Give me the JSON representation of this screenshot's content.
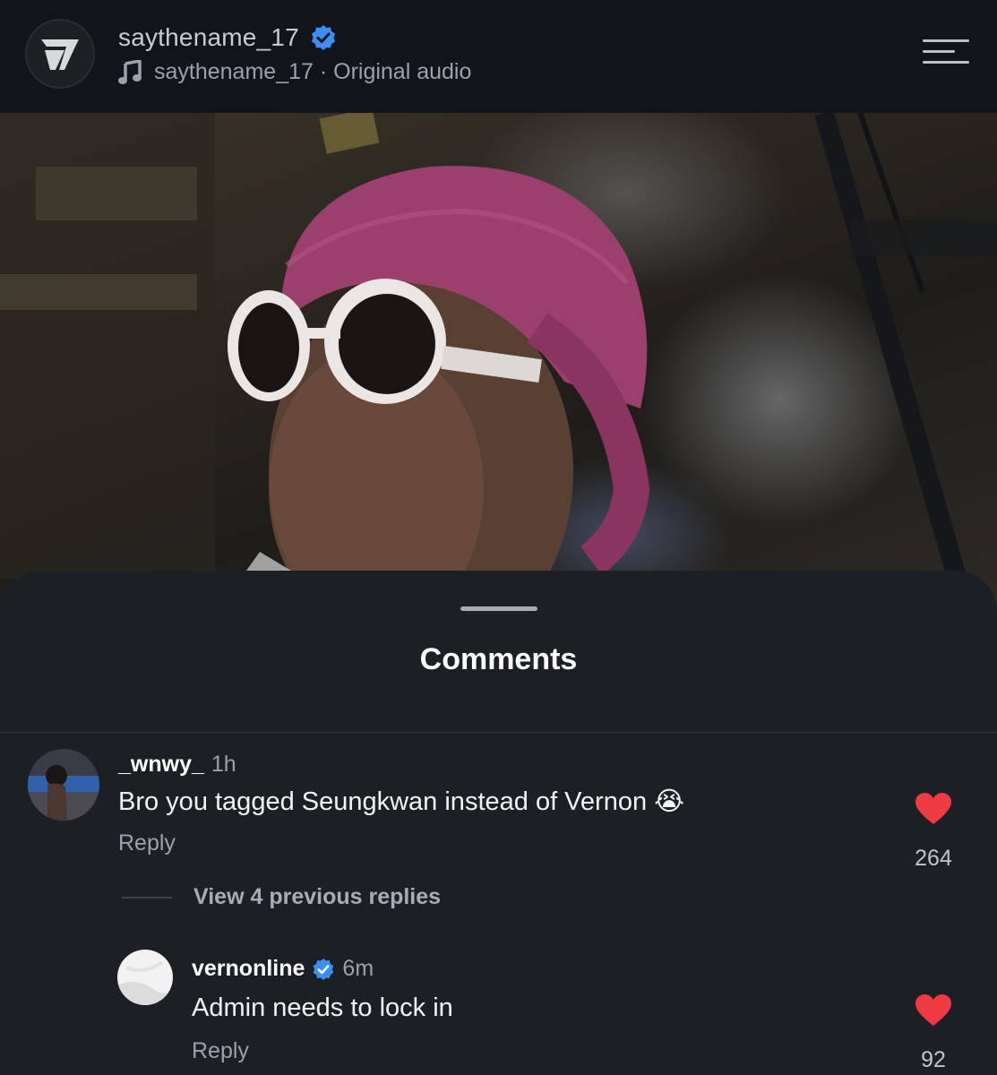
{
  "header": {
    "username": "saythename_17",
    "audio_text": "saythename_17 · Original audio",
    "icons": {
      "logo": "seventeen-logo-icon",
      "verified": "verified-badge-icon",
      "audio": "music-note-icon",
      "menu": "menu-icon"
    }
  },
  "video": {
    "description_icon": "video-frame"
  },
  "comments_sheet": {
    "title": "Comments",
    "view_replies": "View 4 previous replies",
    "comments": [
      {
        "username": "_wnwy_",
        "time": "1h",
        "text": "Bro you tagged Seungkwan instead of Vernon 😭",
        "reply_label": "Reply",
        "likes": "264"
      },
      {
        "username": "vernonline",
        "verified": true,
        "time": "6m",
        "text": "Admin needs to lock in",
        "reply_label": "Reply",
        "likes": "92"
      }
    ]
  },
  "colors": {
    "accent_verified": "#3a8ef6",
    "like_red": "#ef3a44",
    "background": "#1c1f24",
    "header_bg": "#111418"
  }
}
